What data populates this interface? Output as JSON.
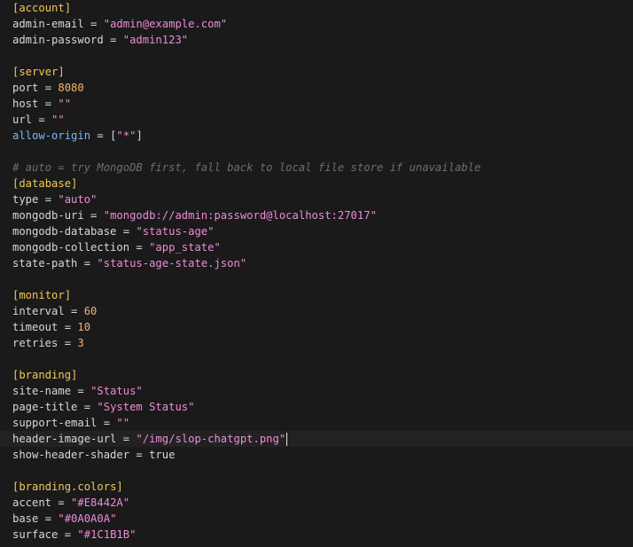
{
  "lines": [
    {
      "section": "account"
    },
    {
      "key": "admin-email",
      "value": "\"admin@example.com\"",
      "vtype": "str"
    },
    {
      "key": "admin-password",
      "value": "\"admin123\"",
      "vtype": "str"
    },
    {},
    {
      "section": "server"
    },
    {
      "key": "port",
      "value": "8080",
      "vtype": "num"
    },
    {
      "key": "host",
      "value": "\"\"",
      "vtype": "str"
    },
    {
      "key": "url",
      "value": "\"\"",
      "vtype": "str"
    },
    {
      "key": "allow-origin",
      "value": "[\"*\"]",
      "vtype": "arr",
      "keyStyle": "special"
    },
    {},
    {
      "comment": "# auto = try MongoDB first, fall back to local file store if unavailable"
    },
    {
      "section": "database"
    },
    {
      "key": "type",
      "value": "\"auto\"",
      "vtype": "str"
    },
    {
      "key": "mongodb-uri",
      "value": "\"mongodb://admin:password@localhost:27017\"",
      "vtype": "str"
    },
    {
      "key": "mongodb-database",
      "value": "\"status-age\"",
      "vtype": "str"
    },
    {
      "key": "mongodb-collection",
      "value": "\"app_state\"",
      "vtype": "str"
    },
    {
      "key": "state-path",
      "value": "\"status-age-state.json\"",
      "vtype": "str"
    },
    {},
    {
      "section": "monitor"
    },
    {
      "key": "interval",
      "value": "60",
      "vtype": "num"
    },
    {
      "key": "timeout",
      "value": "10",
      "vtype": "num"
    },
    {
      "key": "retries",
      "value": "3",
      "vtype": "num"
    },
    {},
    {
      "section": "branding"
    },
    {
      "key": "site-name",
      "value": "\"Status\"",
      "vtype": "str"
    },
    {
      "key": "page-title",
      "value": "\"System Status\"",
      "vtype": "str"
    },
    {
      "key": "support-email",
      "value": "\"\"",
      "vtype": "str"
    },
    {
      "key": "header-image-url",
      "value": "\"/img/slop-chatgpt.png\"",
      "vtype": "str",
      "active": true
    },
    {
      "key": "show-header-shader",
      "value": "true",
      "vtype": "bool"
    },
    {},
    {
      "section": "branding.colors"
    },
    {
      "key": "accent",
      "value": "\"#E8442A\"",
      "vtype": "str"
    },
    {
      "key": "base",
      "value": "\"#0A0A0A\"",
      "vtype": "str"
    },
    {
      "key": "surface",
      "value": "\"#1C1B1B\"",
      "vtype": "str"
    }
  ]
}
